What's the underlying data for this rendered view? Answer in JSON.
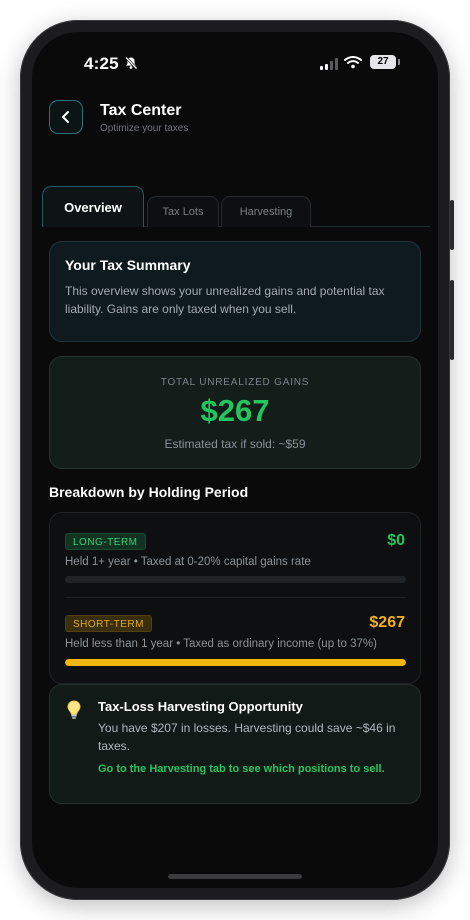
{
  "status_bar": {
    "time": "4:25",
    "battery": "27"
  },
  "header": {
    "title": "Tax Center",
    "subtitle": "Optimize your taxes"
  },
  "tabs": [
    {
      "label": "Overview",
      "active": true
    },
    {
      "label": "Tax Lots",
      "active": false
    },
    {
      "label": "Harvesting",
      "active": false
    }
  ],
  "summary": {
    "title": "Your Tax Summary",
    "body": "This overview shows your unrealized gains and potential tax liability. Gains are only taxed when you sell."
  },
  "gains": {
    "label": "TOTAL UNREALIZED GAINS",
    "value": "$267",
    "estimate": "Estimated tax if sold: ~$59"
  },
  "breakdown": {
    "title": "Breakdown by Holding Period",
    "long_term": {
      "badge": "LONG-TERM",
      "amount": "$0",
      "description": "Held 1+ year • Taxed at 0-20% capital gains rate",
      "progress": 0
    },
    "short_term": {
      "badge": "SHORT-TERM",
      "amount": "$267",
      "description": "Held less than 1 year • Taxed as ordinary income (up to 37%)",
      "progress": 1
    }
  },
  "tip": {
    "icon": "lightbulb-icon",
    "title": "Tax-Loss Harvesting Opportunity",
    "body": "You have $207 in losses. Harvesting could save ~$46 in taxes.",
    "cta": "Go to the Harvesting tab to see which positions to sell."
  },
  "colors": {
    "accent_green": "#22c55e",
    "accent_yellow": "#f2b70f",
    "background": "#0a0a0b"
  }
}
